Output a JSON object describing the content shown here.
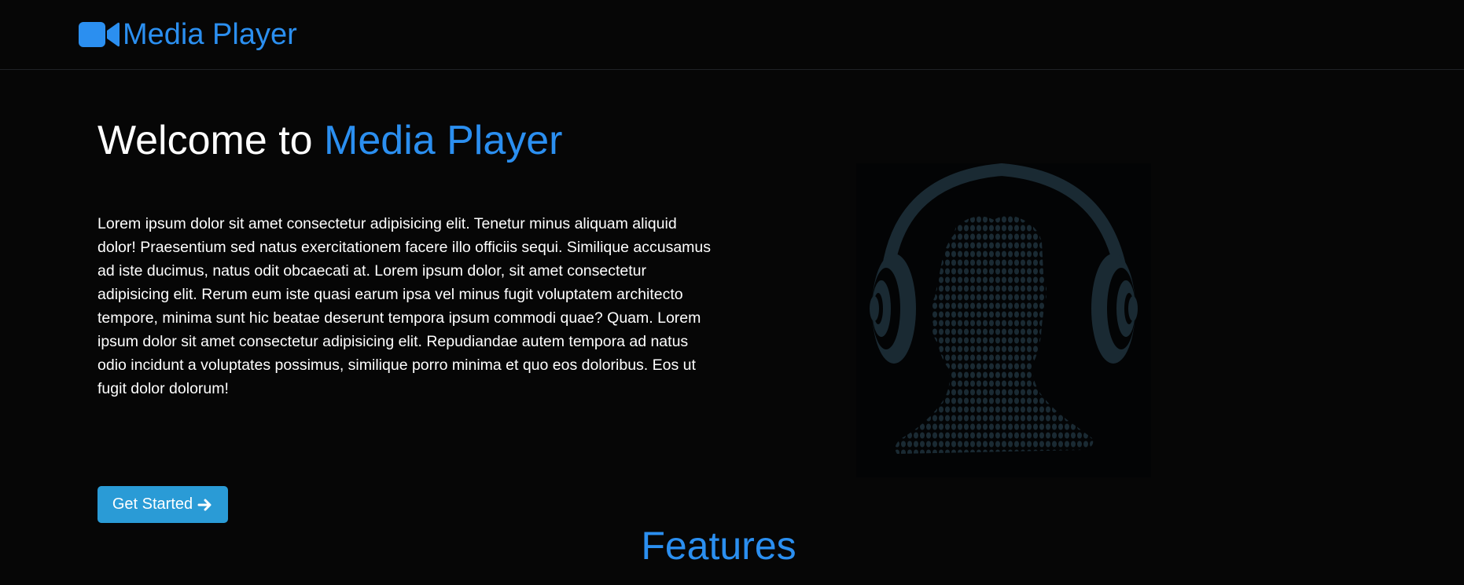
{
  "navbar": {
    "brand_text": "Media Player",
    "brand_icon": "video-camera-icon"
  },
  "hero": {
    "title_prefix": "Welcome to ",
    "title_accent": "Media Player",
    "paragraph": "Lorem ipsum dolor sit amet consectetur adipisicing elit. Tenetur minus aliquam aliquid dolor! Praesentium sed natus exercitationem facere illo officiis sequi. Similique accusamus ad iste ducimus, natus odit obcaecati at. Lorem ipsum dolor, sit amet consectetur adipisicing elit. Rerum eum iste quasi earum ipsa vel minus fugit voluptatem architecto tempore, minima sunt hic beatae deserunt tempora ipsum commodi quae? Quam. Lorem ipsum dolor sit amet consectetur adipisicing elit. Repudiandae autem tempora ad natus odio incidunt a voluptates possimus, similique porro minima et quo eos doloribus. Eos ut fugit dolor dolorum!",
    "cta_label": "Get Started",
    "cta_icon": "arrow-right-icon",
    "image_icon": "headphones-head-icon"
  },
  "features": {
    "title": "Features"
  },
  "colors": {
    "background": "#060606",
    "accent": "#2b8ff0",
    "button": "#2a9bd6",
    "illustration": "#1a2a33"
  }
}
